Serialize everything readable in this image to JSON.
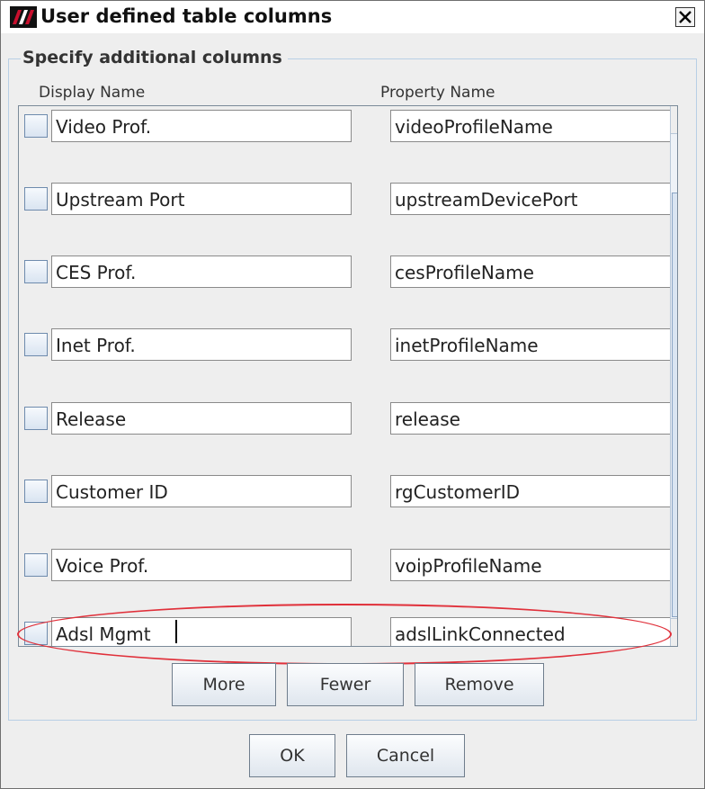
{
  "window": {
    "title": "User defined table columns",
    "icon": "app-logo-icon",
    "close_icon": "close-icon"
  },
  "group": {
    "title": "Specify additional columns"
  },
  "columns": {
    "display_header": "Display Name",
    "property_header": "Property Name"
  },
  "rows": [
    {
      "display": "Video Prof.",
      "property": "videoProfileName",
      "checked": false
    },
    {
      "display": "Upstream Port",
      "property": "upstreamDevicePort",
      "checked": false
    },
    {
      "display": "CES Prof.",
      "property": "cesProfileName",
      "checked": false
    },
    {
      "display": "Inet Prof.",
      "property": "inetProfileName",
      "checked": false
    },
    {
      "display": "Release",
      "property": "release",
      "checked": false
    },
    {
      "display": "Customer ID",
      "property": "rgCustomerID",
      "checked": false
    },
    {
      "display": "Voice Prof.",
      "property": "voipProfileName",
      "checked": false
    },
    {
      "display": "Adsl Mgmt",
      "property": "adslLinkConnected",
      "checked": false
    }
  ],
  "list_buttons": {
    "more": "More",
    "fewer": "Fewer",
    "remove": "Remove"
  },
  "dialog_buttons": {
    "ok": "OK",
    "cancel": "Cancel"
  },
  "annotation": {
    "highlight_color": "#e0303a"
  }
}
